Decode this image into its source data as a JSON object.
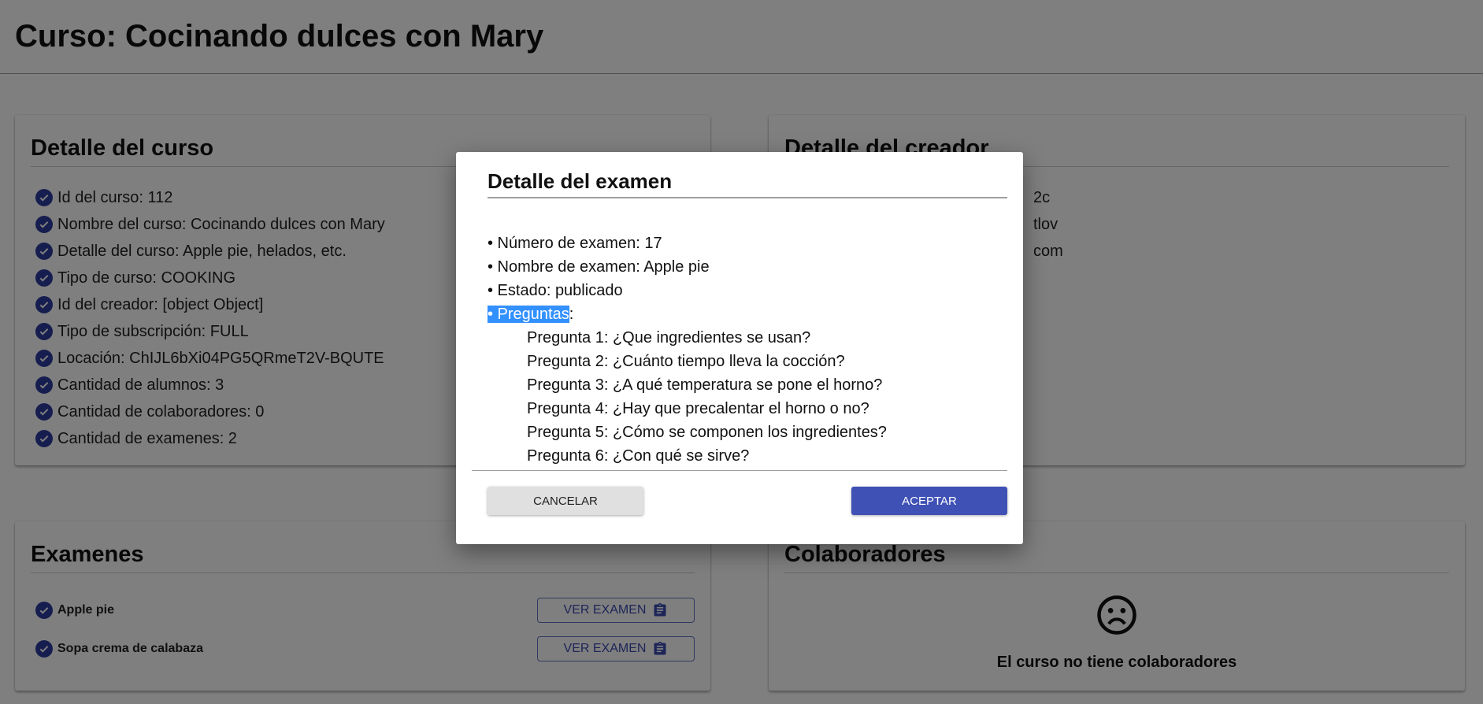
{
  "page": {
    "title": "Curso: Cocinando dulces con Mary"
  },
  "course_card": {
    "title": "Detalle del curso",
    "items": [
      "Id del curso: 112",
      "Nombre del curso: Cocinando dulces con Mary",
      "Detalle del curso: Apple pie, helados, etc.",
      "Tipo de curso: COOKING",
      "Id del creador: [object Object]",
      "Tipo de subscripción: FULL",
      "Locación: ChIJL6bXi04PG5QRmeT2V-BQUTE",
      "Cantidad de alumnos: 3",
      "Cantidad de colaboradores: 0",
      "Cantidad de examenes: 2"
    ]
  },
  "creator_card": {
    "title": "Detalle del creador",
    "items": [
      "2c",
      "tlov",
      "com"
    ]
  },
  "exams_card": {
    "title": "Examenes",
    "exams": [
      {
        "name": "Apple pie",
        "button": "VER EXAMEN"
      },
      {
        "name": "Sopa crema de calabaza",
        "button": "VER EXAMEN"
      }
    ]
  },
  "collab_card": {
    "title": "Colaboradores",
    "empty_text": "El curso no tiene colaboradores"
  },
  "dialog": {
    "title": "Detalle del examen",
    "exam_number": "• Número de examen: 17",
    "exam_name": "• Nombre de examen: Apple pie",
    "status": "• Estado: publicado",
    "questions_label_highlighted": "• Preguntas",
    "questions_label_rest": ":",
    "questions": [
      "Pregunta 1: ¿Que ingredientes se usan?",
      "Pregunta 2: ¿Cuánto tiempo lleva la cocción?",
      "Pregunta 3: ¿A qué temperatura se pone el horno?",
      "Pregunta 4: ¿Hay que precalentar el horno o no?",
      "Pregunta 5: ¿Cómo se componen los ingredientes?",
      "Pregunta 6: ¿Con qué se sirve?"
    ],
    "cancel_label": "CANCELAR",
    "accept_label": "ACEPTAR"
  },
  "colors": {
    "primary": "#3f51b5",
    "check": "#2c3a9e",
    "highlight": "#3390ff",
    "overlay": "rgba(0,0,0,0.5)"
  }
}
